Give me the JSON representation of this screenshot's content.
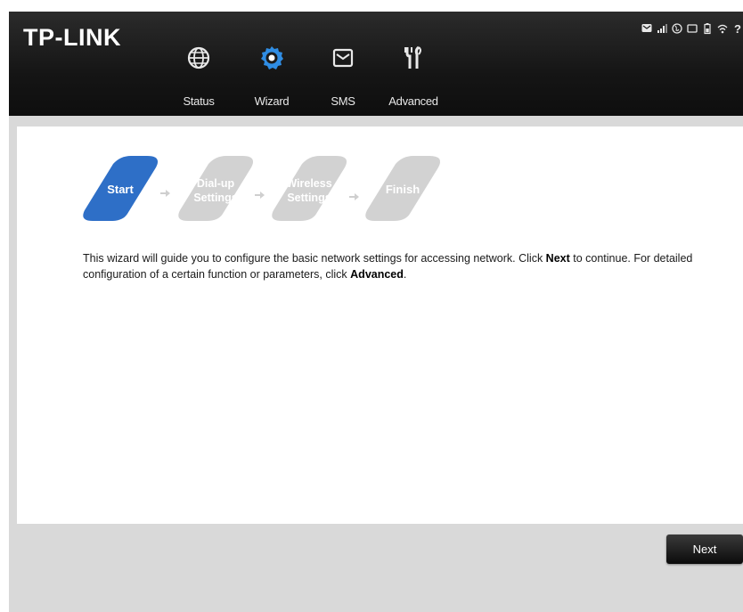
{
  "header": {
    "logo": "TP-LINK",
    "nav": [
      {
        "label": "Status",
        "icon": "globe-icon"
      },
      {
        "label": "Wizard",
        "icon": "wizard-gear-icon",
        "active": true
      },
      {
        "label": "SMS",
        "icon": "envelope-icon"
      },
      {
        "label": "Advanced",
        "icon": "tools-icon"
      }
    ],
    "status_icons": [
      "message-icon",
      "signal-icon",
      "internet-icon",
      "sim-icon",
      "battery-icon",
      "wifi-icon",
      "help-icon"
    ]
  },
  "wizard": {
    "steps": [
      {
        "line1": "Start",
        "line2": "",
        "active": true
      },
      {
        "line1": "Dial-up",
        "line2": "Settings",
        "active": false
      },
      {
        "line1": "Wireless",
        "line2": "Settings",
        "active": false
      },
      {
        "line1": "Finish",
        "line2": "",
        "active": false
      }
    ],
    "description": {
      "part1": "This wizard will guide you to configure the basic network settings for accessing network. Click ",
      "bold1": "Next",
      "part2": " to continue. For detailed configuration of a certain function or parameters, click ",
      "bold2": "Advanced",
      "part3": "."
    }
  },
  "footer": {
    "next_label": "Next"
  },
  "colors": {
    "active_step": "#2e6fc7",
    "inactive_step": "#d2d2d2",
    "header_bg": "#1a1a1a",
    "active_nav_icon": "#2f8de4"
  }
}
